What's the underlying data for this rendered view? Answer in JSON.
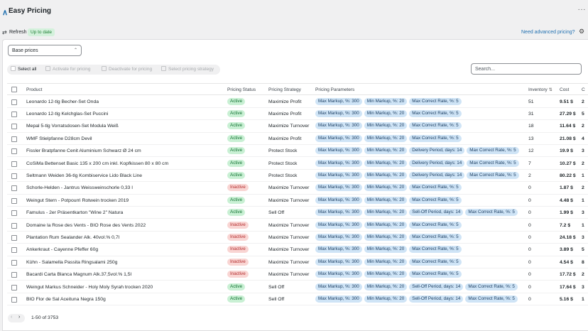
{
  "app": {
    "title": "Easy Pricing",
    "more_icon": "ellipsis-icon",
    "logo_icon": "logo-chevron-icon"
  },
  "status_row": {
    "refresh_label": "Refresh",
    "status_badge": "Up to date",
    "advanced_link": "Need advanced pricing?"
  },
  "controls": {
    "price_select": "Base prices",
    "select_all": "Select all",
    "activate": "Activate for pricing",
    "deactivate": "Deactivate for pricing",
    "select_strategy": "Select pricing strategy",
    "search_placeholder": "Search..."
  },
  "columns": [
    "Product",
    "Pricing Status",
    "Pricing Strategy",
    "Pricing Parameters",
    "Inventory",
    "Cost",
    "C"
  ],
  "colors": {
    "accent": "#2271b1",
    "active_bg": "#c9f0d4",
    "inactive_bg": "#f9d5d3",
    "param_bg": "#cfe4f6"
  },
  "rows": [
    {
      "product": "Leonardo 12-tlg Becher-Set Onda",
      "status": "Active",
      "strategy": "Maximize Profit",
      "params": [
        "Max Markup, %: 300",
        "Min Markup, %: 20",
        "Max Correct Rate, %: 5"
      ],
      "inventory": "51",
      "cost": "9.51 $",
      "cut": "2"
    },
    {
      "product": "Leonardo 12-tlg Kelchglas-Set Puccini",
      "status": "Active",
      "strategy": "Maximize Profit",
      "params": [
        "Max Markup, %: 300",
        "Min Markup, %: 20",
        "Max Correct Rate, %: 5"
      ],
      "inventory": "31",
      "cost": "27.29 $",
      "cut": "5"
    },
    {
      "product": "Mepal 5-tlg Vorratsdosen-Set Modula Weiß",
      "status": "Active",
      "strategy": "Maximize Turnover",
      "params": [
        "Max Markup, %: 300",
        "Min Markup, %: 20",
        "Max Correct Rate, %: 5"
      ],
      "inventory": "18",
      "cost": "11.64 $",
      "cut": "2"
    },
    {
      "product": "WMF Stielpfanne D28cm Devil",
      "status": "Active",
      "strategy": "Maximize Profit",
      "params": [
        "Max Markup, %: 300",
        "Min Markup, %: 20",
        "Max Correct Rate, %: 5"
      ],
      "inventory": "13",
      "cost": "21.08 $",
      "cut": "4"
    },
    {
      "product": "Fissler Bratpfanne Cenit Aluminium Schwarz Ø 24 cm",
      "status": "Active",
      "strategy": "Protect Stock",
      "params": [
        "Max Markup, %: 300",
        "Min Markup, %: 20",
        "Delivery Period, days: 14",
        "Max Correct Rate, %: 5"
      ],
      "inventory": "12",
      "cost": "19.9 $",
      "cut": "3"
    },
    {
      "product": "CoSiMa Bettenset Basic 135 x 200 cm inkl. Kopfkissen 80 x 80 cm",
      "status": "Active",
      "strategy": "Protect Stock",
      "params": [
        "Max Markup, %: 300",
        "Min Markup, %: 20",
        "Delivery Period, days: 14",
        "Max Correct Rate, %: 5"
      ],
      "inventory": "7",
      "cost": "10.27 $",
      "cut": "2"
    },
    {
      "product": "Seltmann Weiden 36-tlg Kombiservice Lido Black Line",
      "status": "Active",
      "strategy": "Protect Stock",
      "params": [
        "Max Markup, %: 300",
        "Min Markup, %: 20",
        "Delivery Period, days: 14",
        "Max Correct Rate, %: 5"
      ],
      "inventory": "2",
      "cost": "80.22 $",
      "cut": "1"
    },
    {
      "product": "Schorle-Helden - Jantrus Weissweinschorle 0,33 l",
      "status": "Inactive",
      "strategy": "Maximize Turnover",
      "params": [
        "Max Markup, %: 300",
        "Min Markup, %: 20",
        "Max Correct Rate, %: 5"
      ],
      "inventory": "0",
      "cost": "1.87 $",
      "cut": "2"
    },
    {
      "product": "Weingut Stern - Potpourri Rotwein trocken 2019",
      "status": "Active",
      "strategy": "Maximize Turnover",
      "params": [
        "Max Markup, %: 300",
        "Min Markup, %: 20",
        "Max Correct Rate, %: 5"
      ],
      "inventory": "0",
      "cost": "4.48 $",
      "cut": "1"
    },
    {
      "product": "Famulus - 2er Präsentkarton \"Wine 2\" Natura",
      "status": "Active",
      "strategy": "Sell Off",
      "params": [
        "Max Markup, %: 300",
        "Min Markup, %: 20",
        "Sell-Off Period, days: 14",
        "Max Correct Rate, %: 5"
      ],
      "inventory": "0",
      "cost": "1.99 $",
      "cut": "3"
    },
    {
      "product": "Domaine la Rose des Vents - BIO Rose des Vents 2022",
      "status": "Inactive",
      "strategy": "Maximize Turnover",
      "params": [
        "Max Markup, %: 300",
        "Min Markup, %: 20",
        "Max Correct Rate, %: 5"
      ],
      "inventory": "0",
      "cost": "7.2 $",
      "cut": "1"
    },
    {
      "product": "Plantation Rum Sealander Alk. 40vol.% 0,7l",
      "status": "Inactive",
      "strategy": "Maximize Turnover",
      "params": [
        "Max Markup, %: 300",
        "Min Markup, %: 20",
        "Max Correct Rate, %: 5"
      ],
      "inventory": "0",
      "cost": "24.18 $",
      "cut": "3"
    },
    {
      "product": "Ankerkraut - Cayenne Pfeffer 60g",
      "status": "Inactive",
      "strategy": "Maximize Turnover",
      "params": [
        "Max Markup, %: 300",
        "Min Markup, %: 20",
        "Max Correct Rate, %: 5"
      ],
      "inventory": "0",
      "cost": "3.89 $",
      "cut": "5"
    },
    {
      "product": "Kühn - Salamella Passita Ringsalami 250g",
      "status": "Inactive",
      "strategy": "Maximize Turnover",
      "params": [
        "Max Markup, %: 300",
        "Min Markup, %: 20",
        "Max Correct Rate, %: 5"
      ],
      "inventory": "0",
      "cost": "4.54 $",
      "cut": "8"
    },
    {
      "product": "Bacardi Carta Blanca Magnum Alk.37,5vol.% 1,5l",
      "status": "Inactive",
      "strategy": "Maximize Turnover",
      "params": [
        "Max Markup, %: 300",
        "Min Markup, %: 20",
        "Max Correct Rate, %: 5"
      ],
      "inventory": "0",
      "cost": "17.72 $",
      "cut": "2"
    },
    {
      "product": "Weingut Markus Schneider - Holy Moly Syrah trocken 2020",
      "status": "Active",
      "strategy": "Sell Off",
      "params": [
        "Max Markup, %: 300",
        "Min Markup, %: 20",
        "Sell-Off Period, days: 14",
        "Max Correct Rate, %: 5"
      ],
      "inventory": "0",
      "cost": "17.64 $",
      "cut": "3"
    },
    {
      "product": "BIO Flor de Sal Aceituna Negra 150g",
      "status": "Active",
      "strategy": "Sell Off",
      "params": [
        "Max Markup, %: 300",
        "Min Markup, %: 20",
        "Sell-Off Period, days: 14",
        "Max Correct Rate, %: 5"
      ],
      "inventory": "0",
      "cost": "5.16 $",
      "cut": "1"
    }
  ],
  "pagination": {
    "range": "1-50 of 3753",
    "prev": "‹",
    "next": "›"
  }
}
